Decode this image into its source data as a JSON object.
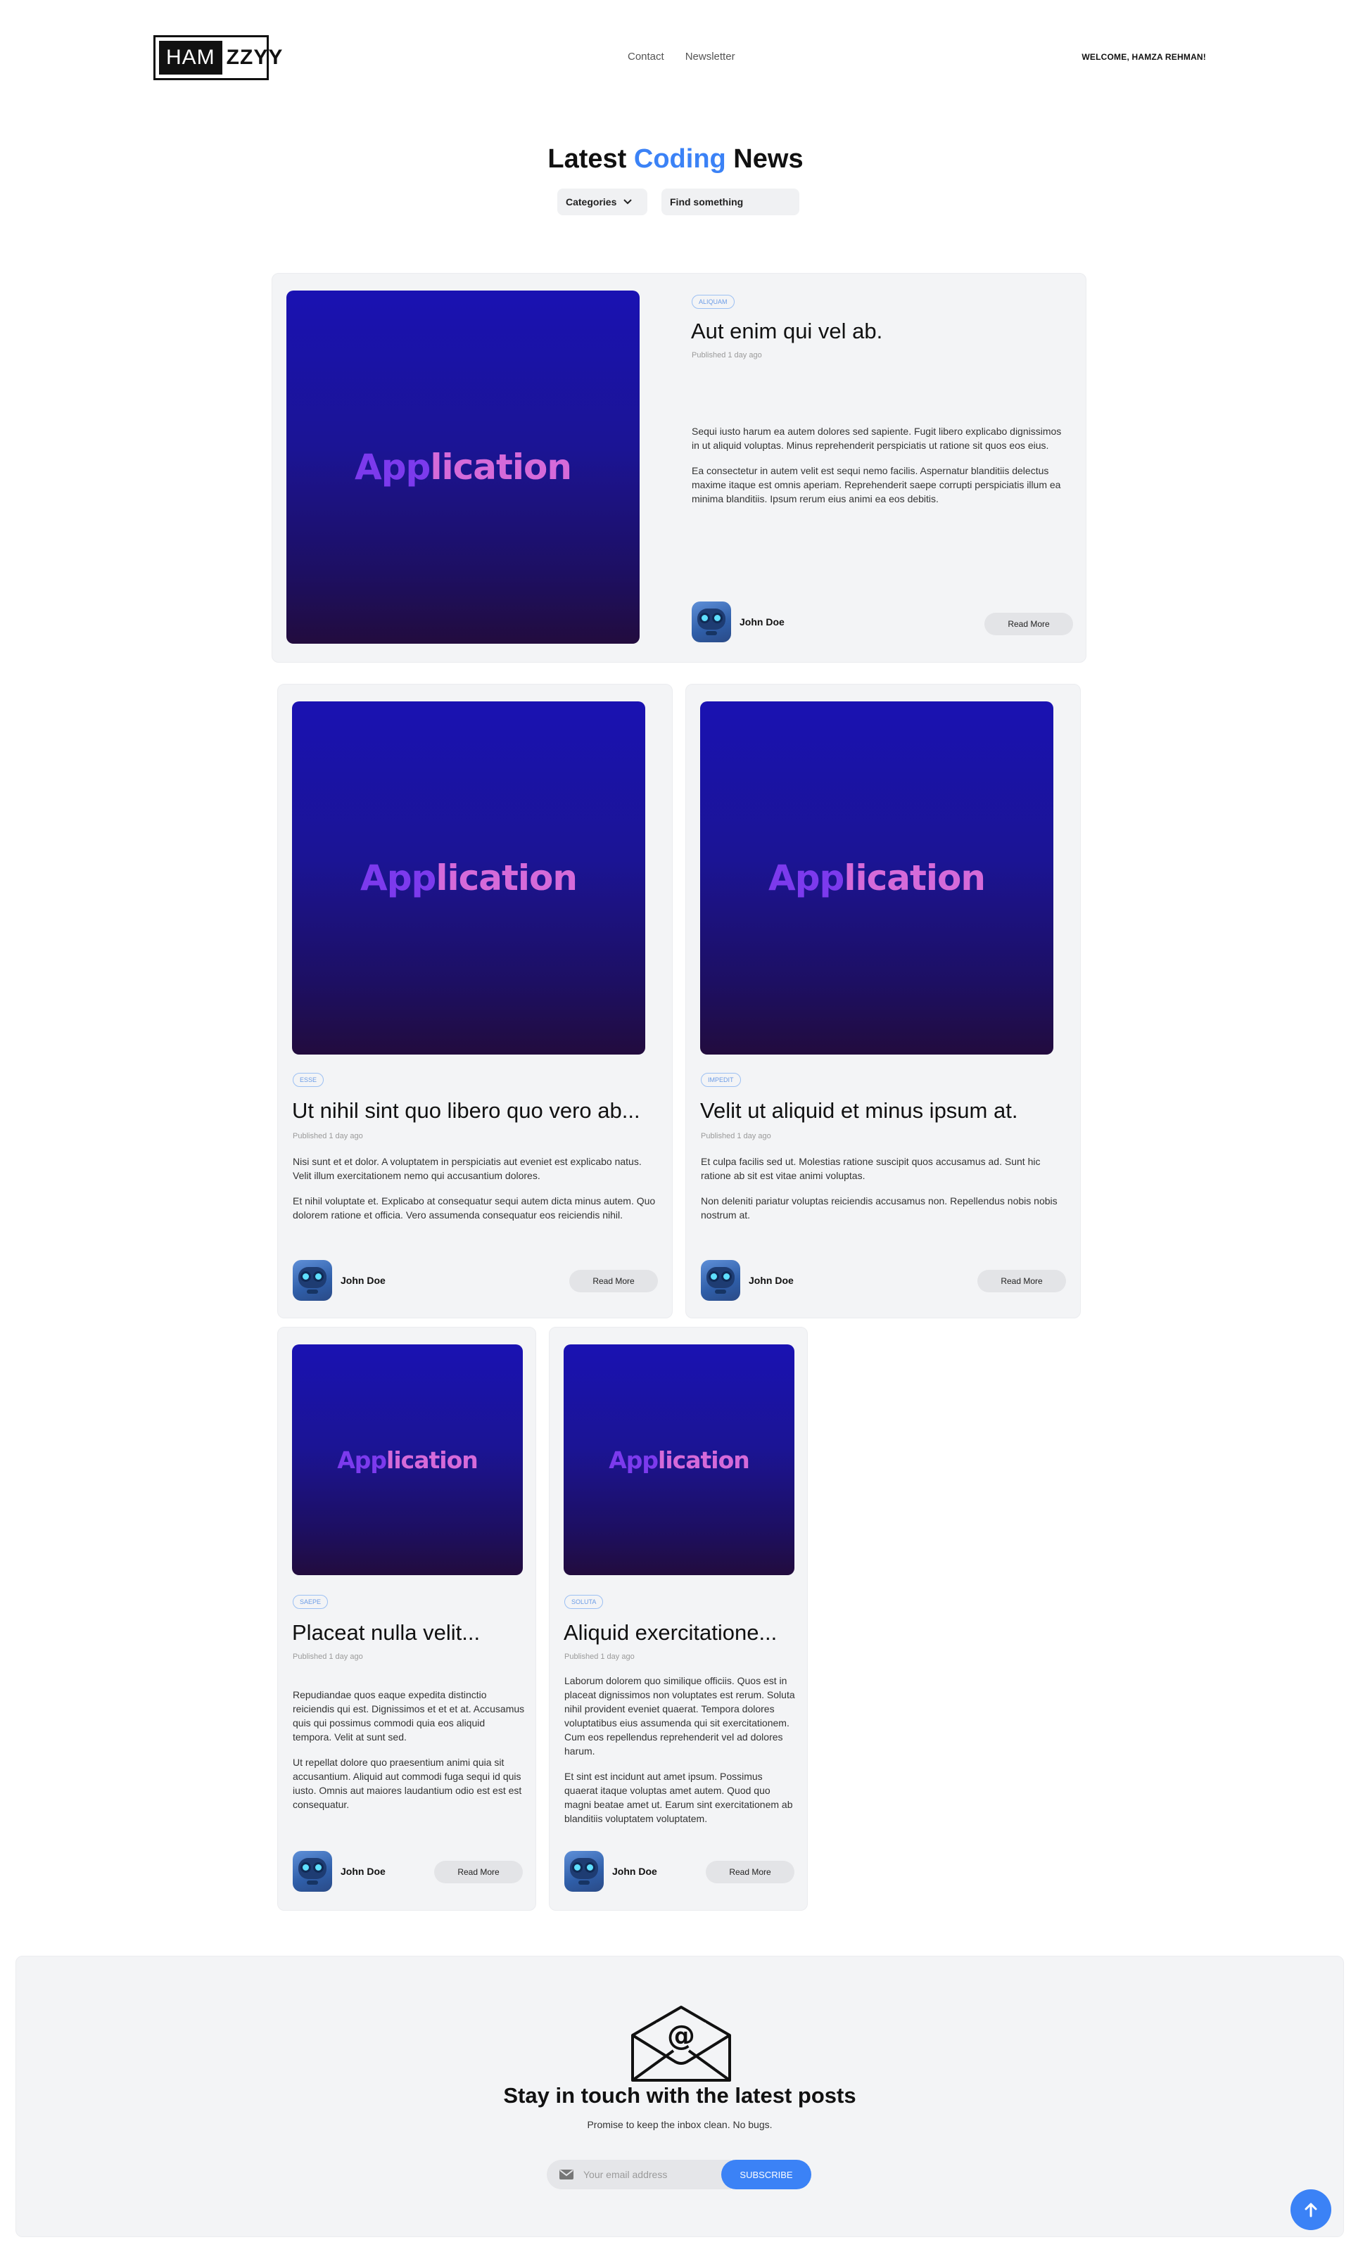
{
  "header": {
    "logo_left": "HAM",
    "logo_right": "ZZYY",
    "nav": [
      {
        "label": "Contact"
      },
      {
        "label": "Newsletter"
      }
    ],
    "welcome": "WELCOME, HAMZA REHMAN!"
  },
  "hero": {
    "title_pre": "Latest ",
    "title_accent": "Coding",
    "title_post": " News",
    "categories_label": "Categories",
    "search_placeholder": "Find something"
  },
  "thumb_text": {
    "part1": "App",
    "part2": "lication"
  },
  "posts": [
    {
      "tag": "ALIQUAM",
      "title": "Aut enim qui vel ab.",
      "published": "Published 1 day ago",
      "paragraphs": [
        "Sequi iusto harum ea autem dolores sed sapiente. Fugit libero explicabo dignissimos in ut aliquid voluptas. Minus reprehenderit perspiciatis ut ratione sit quos eos eius.",
        "Ea consectetur in autem velit est sequi nemo facilis. Aspernatur blanditiis delectus maxime itaque est omnis aperiam. Reprehenderit saepe corrupti perspiciatis illum ea minima blanditiis. Ipsum rerum eius animi ea eos debitis."
      ],
      "author": "John Doe",
      "read_more": "Read More"
    },
    {
      "tag": "ESSE",
      "title": "Ut nihil sint quo libero quo vero ab...",
      "published": "Published 1 day ago",
      "paragraphs": [
        "Nisi sunt et et dolor. A voluptatem in perspiciatis aut eveniet est explicabo natus. Velit illum exercitationem nemo qui accusantium dolores.",
        "Et nihil voluptate et. Explicabo at consequatur sequi autem dicta minus autem. Quo dolorem ratione et officia. Vero assumenda consequatur eos reiciendis nihil."
      ],
      "author": "John Doe",
      "read_more": "Read More"
    },
    {
      "tag": "IMPEDIT",
      "title": "Velit ut aliquid et minus ipsum at.",
      "published": "Published 1 day ago",
      "paragraphs": [
        "Et culpa facilis sed ut. Molestias ratione suscipit quos accusamus ad. Sunt hic ratione ab sit est vitae animi voluptas.",
        "Non deleniti pariatur voluptas reiciendis accusamus non. Repellendus nobis nobis nostrum at."
      ],
      "author": "John Doe",
      "read_more": "Read More"
    },
    {
      "tag": "SAEPE",
      "title": "Placeat nulla velit...",
      "published": "Published 1 day ago",
      "paragraphs": [
        "Repudiandae quos eaque expedita distinctio reiciendis qui est. Dignissimos et et et at. Accusamus quis qui possimus commodi quia eos aliquid tempora. Velit at sunt sed.",
        "Ut repellat dolore quo praesentium animi quia sit accusantium. Aliquid aut commodi fuga sequi id quis iusto. Omnis aut maiores laudantium odio est est est consequatur."
      ],
      "author": "John Doe",
      "read_more": "Read More"
    },
    {
      "tag": "SOLUTA",
      "title": "Aliquid exercitatione...",
      "published": "Published 1 day ago",
      "paragraphs": [
        "Laborum dolorem quo similique officiis. Quos est in placeat dignissimos non voluptates est rerum. Soluta nihil provident eveniet quaerat. Tempora dolores voluptatibus eius assumenda qui sit exercitationem. Cum eos repellendus reprehenderit vel ad dolores harum.",
        "Et sint est incidunt aut amet ipsum. Possimus quaerat itaque voluptas amet autem. Quod quo magni beatae amet ut. Earum sint exercitationem ab blanditiis voluptatem voluptatem."
      ],
      "author": "John Doe",
      "read_more": "Read More"
    }
  ],
  "newsletter": {
    "title": "Stay in touch with the latest posts",
    "subtitle": "Promise to keep the inbox clean. No bugs.",
    "email_placeholder": "Your email address",
    "button": "SUBSCRIBE"
  },
  "colors": {
    "accent": "#3b82f6",
    "card_bg": "#f3f4f6"
  }
}
